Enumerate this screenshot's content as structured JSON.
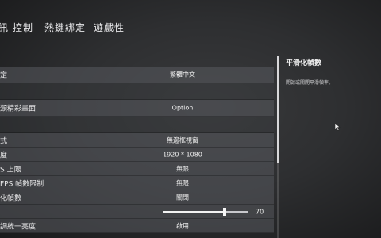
{
  "tabs": [
    {
      "label": "訊"
    },
    {
      "label": "控制"
    },
    {
      "label": "熱鍵綁定"
    },
    {
      "label": "遊戲性"
    }
  ],
  "settings": [
    {
      "label": "定",
      "value": "繁體中文"
    },
    {
      "label": "",
      "value": ""
    },
    {
      "label": "類精彩畫面",
      "value": "Option"
    },
    {
      "label": "",
      "value": ""
    },
    {
      "label": "式",
      "value": "無邊框視窗"
    },
    {
      "label": "度",
      "value": "1920 * 1080"
    },
    {
      "label": "S 上限",
      "value": "無限"
    },
    {
      "label": "FPS 幀數限制",
      "value": "無限"
    },
    {
      "label": "化幀數",
      "value": "關閉"
    },
    {
      "label": "",
      "value": "70",
      "slider_fraction": 0.72
    },
    {
      "label": "調統一亮度",
      "value": "啟用"
    }
  ],
  "info": {
    "title": "平滑化幀數",
    "description": "開啟或關閉平滑幀率。"
  }
}
